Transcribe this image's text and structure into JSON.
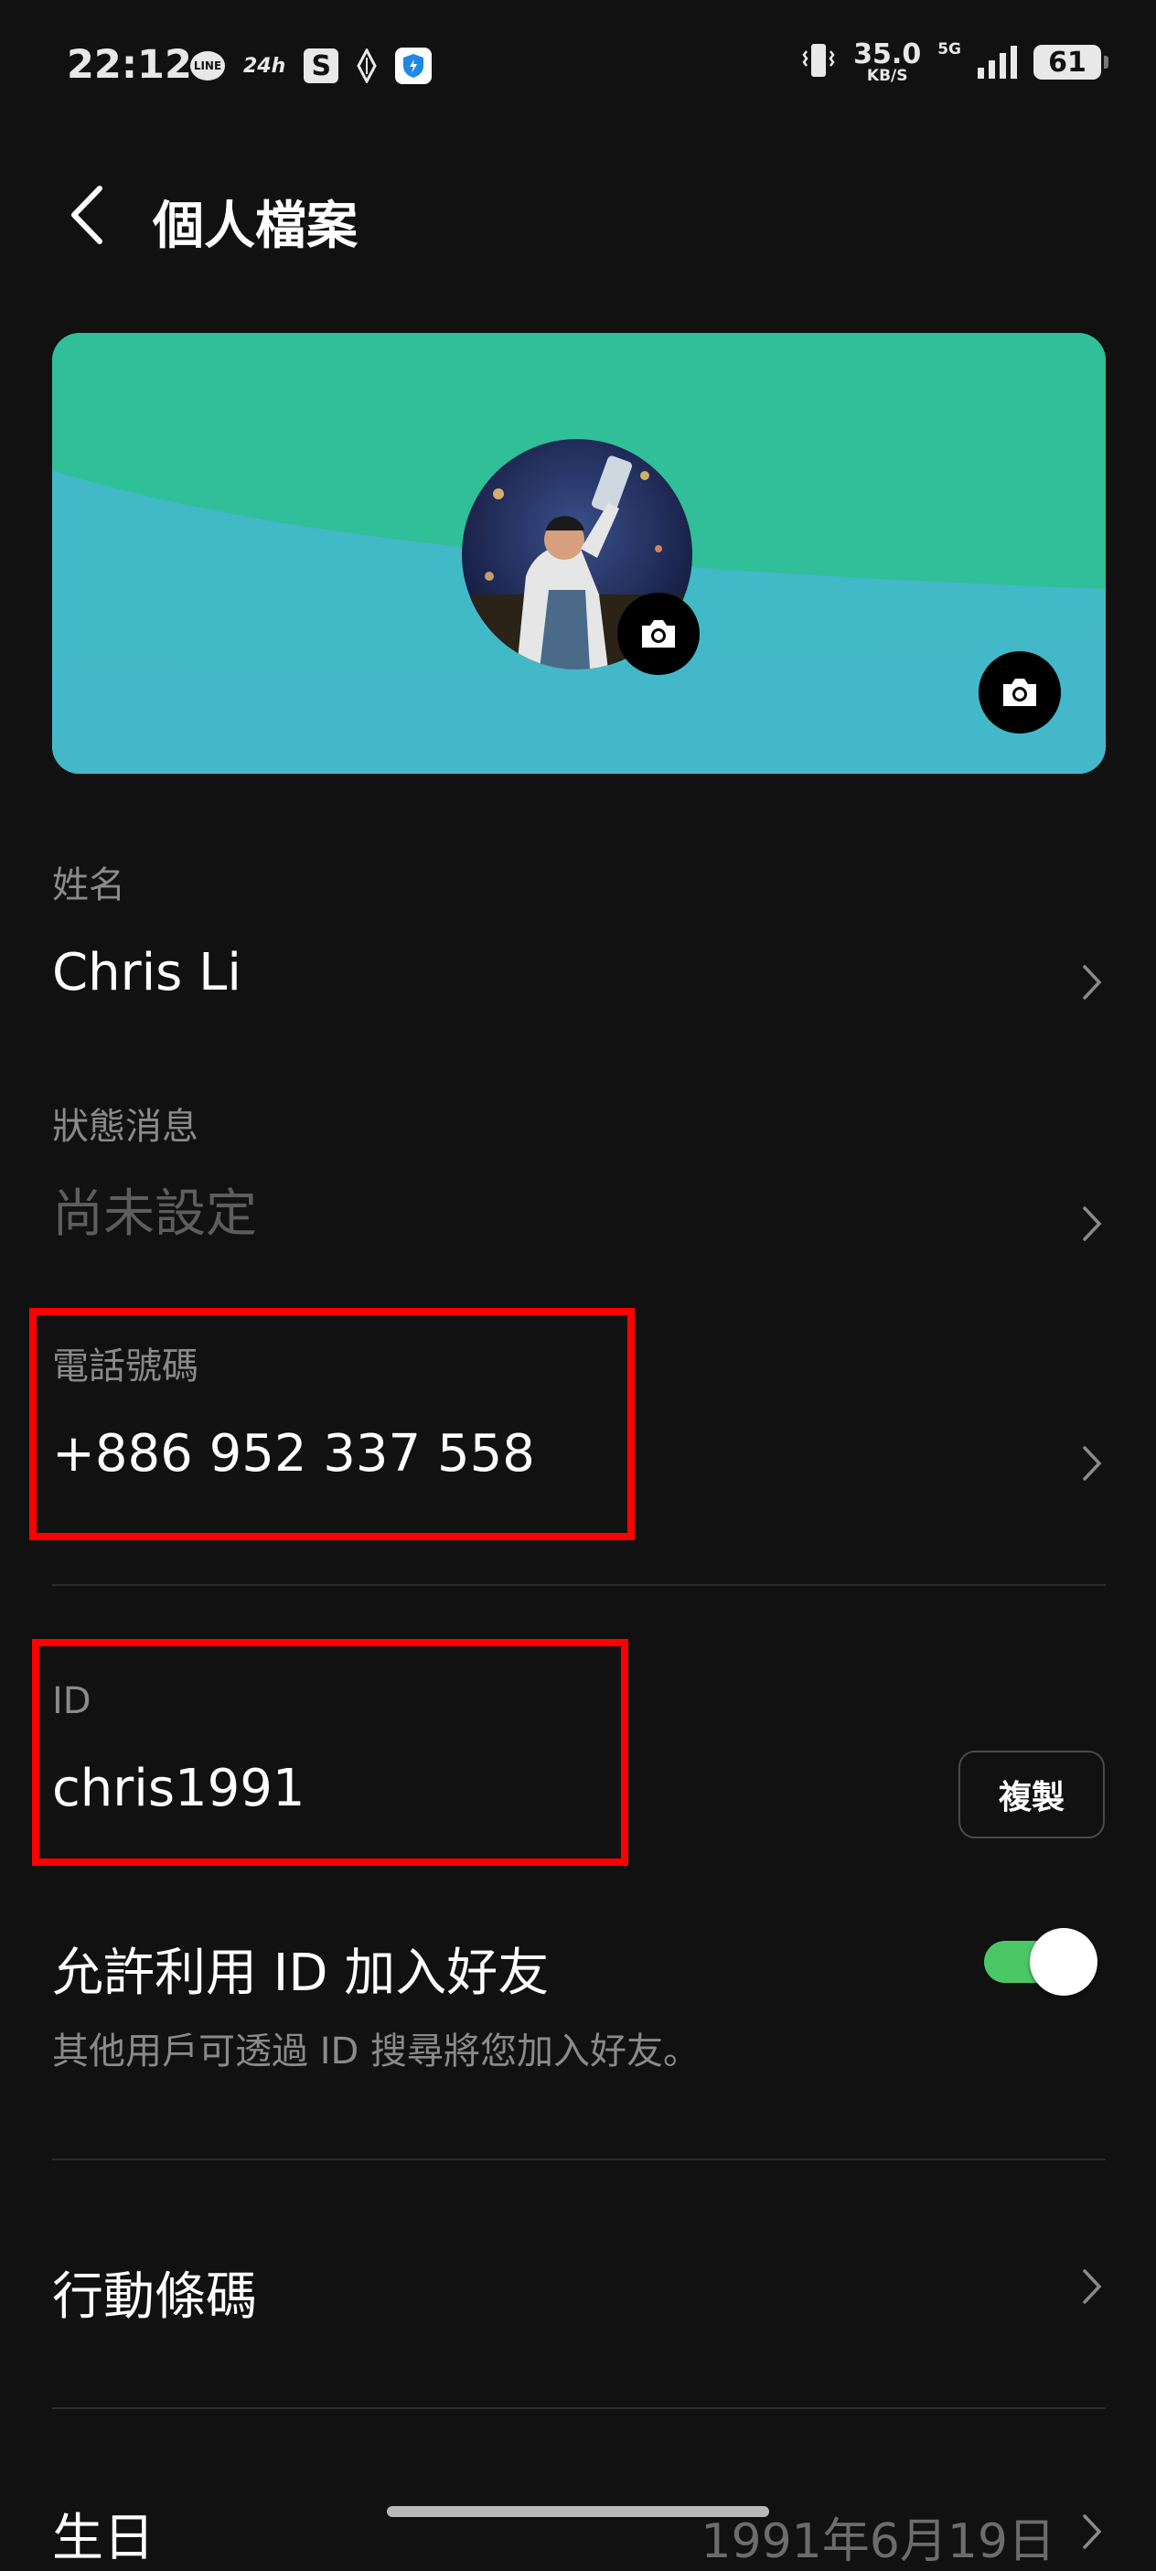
{
  "status_bar": {
    "time": "22:12",
    "left_icons": [
      "line-notification-icon",
      "24h-app-icon",
      "s-app-icon",
      "diamond-app-icon",
      "vpn-shield-icon"
    ],
    "line_label": "LINE",
    "app_24_label": "24h",
    "s_label": "S",
    "net_speed": "35.0",
    "net_unit": "KB/S",
    "network_type": "5G",
    "battery": "61"
  },
  "header": {
    "title": "個人檔案"
  },
  "profile": {
    "name_label": "姓名",
    "name_value": "Chris Li",
    "status_label": "狀態消息",
    "status_value": "尚未設定",
    "phone_label": "電話號碼",
    "phone_value": "+886 952 337 558",
    "id_label": "ID",
    "id_value": "chris1991",
    "copy_label": "複製",
    "allow_id_title": "允許利用 ID 加入好友",
    "allow_id_desc": "其他用戶可透過 ID 搜尋將您加入好友。",
    "allow_id_enabled": true,
    "barcode_label": "行動條碼",
    "birthday_label": "生日",
    "birthday_value": "1991年6月19日"
  },
  "colors": {
    "background": "#111111",
    "cover_green": "#30bf98",
    "cover_teal": "#42b9c6",
    "toggle_on": "#4cc765",
    "highlight_box": "#ff0000"
  }
}
